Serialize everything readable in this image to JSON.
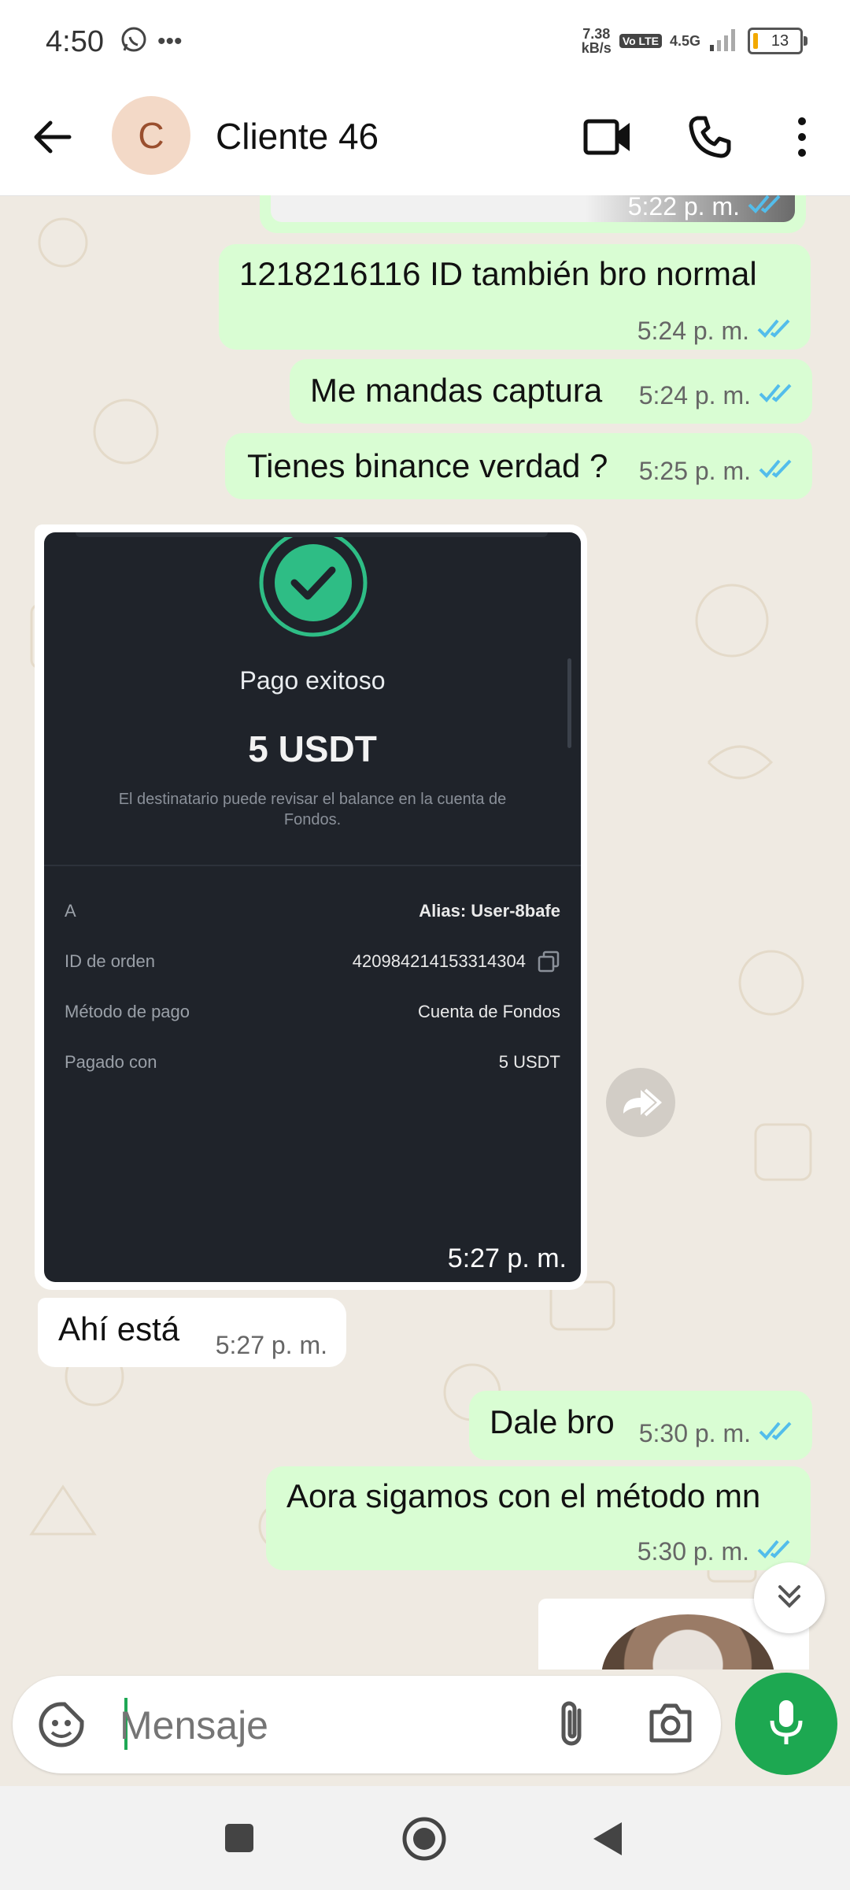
{
  "status_bar": {
    "time": "4:50",
    "net_speed_value": "7.38",
    "net_speed_unit": "kB/s",
    "volte_label": "Vo LTE",
    "network_label": "4.5G",
    "battery_level": "13"
  },
  "header": {
    "avatar_letter": "C",
    "contact_name": "Cliente 46"
  },
  "messages": [
    {
      "text": "",
      "time": "5:22 p. m."
    },
    {
      "text": "1218216116 ID también bro normal",
      "time": "5:24 p. m."
    },
    {
      "text": "Me mandas captura",
      "time": "5:24 p. m."
    },
    {
      "text": "Tienes binance verdad ?",
      "time": "5:25 p. m."
    },
    {
      "text": "",
      "time": "5:27 p. m."
    },
    {
      "text": "Ahí está",
      "time": "5:27 p. m."
    },
    {
      "text": "Dale bro",
      "time": "5:30 p. m."
    },
    {
      "text": "Aora sigamos con el método mn",
      "time": "5:30 p. m."
    }
  ],
  "receipt": {
    "title": "Pago exitoso",
    "amount": "5 USDT",
    "note": "El destinatario puede revisar el balance en la cuenta de Fondos.",
    "rows": [
      {
        "label": "A",
        "value": "Alias: User-8bafe"
      },
      {
        "label": "ID de orden",
        "value": "420984214153314304"
      },
      {
        "label": "Método de pago",
        "value": "Cuenta de Fondos"
      },
      {
        "label": "Pagado con",
        "value": "5 USDT"
      }
    ]
  },
  "composer": {
    "placeholder": "Mensaje"
  },
  "colors": {
    "outgoing_bubble": "#d9fdd3",
    "incoming_bubble": "#ffffff",
    "accent_green": "#1da851",
    "read_ticks": "#53bdeb"
  },
  "icons": [
    "back-arrow-icon",
    "video-call-icon",
    "phone-icon",
    "more-vert-icon",
    "read-ticks-icon",
    "forward-icon",
    "double-chevron-down-icon",
    "sticker-icon",
    "attach-icon",
    "camera-icon",
    "mic-icon",
    "nav-recents-icon",
    "nav-home-icon",
    "nav-back-icon"
  ]
}
